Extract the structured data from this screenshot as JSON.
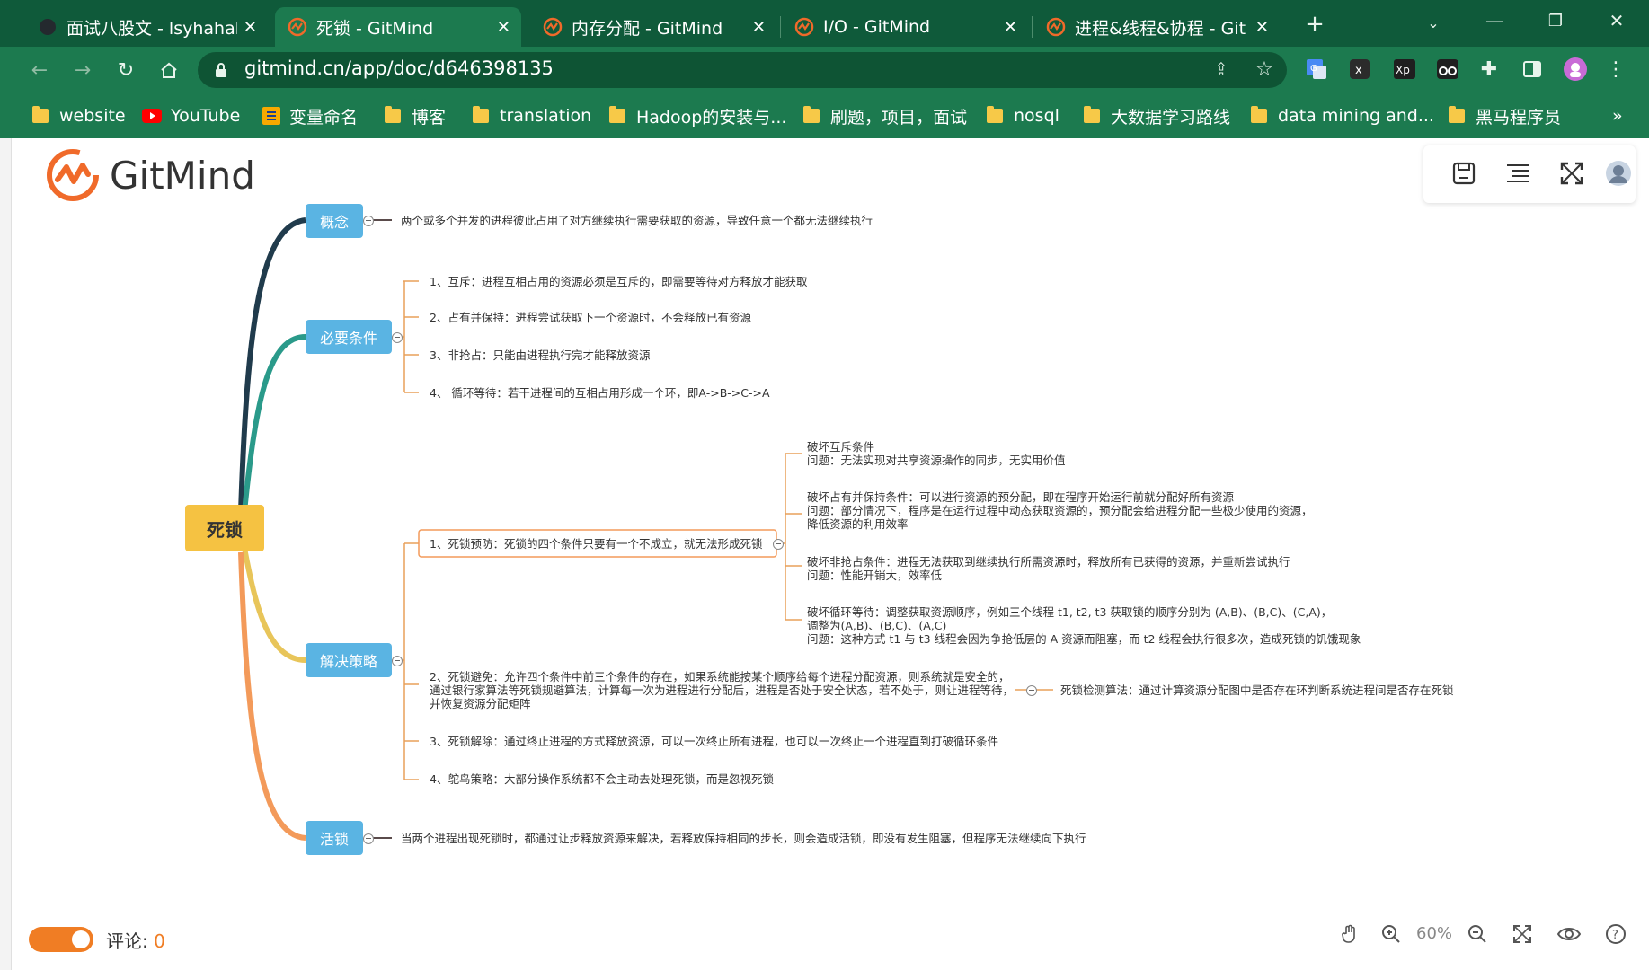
{
  "browser": {
    "tabs": [
      {
        "title": "面试八股文 - lsyhahah",
        "active": false
      },
      {
        "title": "死锁 - GitMind",
        "active": true
      },
      {
        "title": "内存分配 - GitMind",
        "active": false
      },
      {
        "title": "I/O - GitMind",
        "active": false
      },
      {
        "title": "进程&线程&协程 - Git",
        "active": false
      }
    ],
    "url": "gitmind.cn/app/doc/d646398135",
    "bookmarks": [
      {
        "label": "website",
        "icon": "folder-icon"
      },
      {
        "label": "YouTube",
        "icon": "youtube-icon"
      },
      {
        "label": "变量命名",
        "icon": "bookmark-icon"
      },
      {
        "label": "博客",
        "icon": "folder-icon"
      },
      {
        "label": "translation",
        "icon": "folder-icon"
      },
      {
        "label": "Hadoop的安装与...",
        "icon": "folder-icon"
      },
      {
        "label": "刷题，项目，面试",
        "icon": "folder-icon"
      },
      {
        "label": "nosql",
        "icon": "folder-icon"
      },
      {
        "label": "大数据学习路线",
        "icon": "folder-icon"
      },
      {
        "label": "data mining and...",
        "icon": "folder-icon"
      },
      {
        "label": "黑马程序员",
        "icon": "folder-icon"
      }
    ],
    "more_bookmarks": "»"
  },
  "app": {
    "logo_text": "GitMind",
    "zoom": "60%",
    "comment_label": "评论: ",
    "comment_count": "0",
    "colors": {
      "topic": "#5ab4e3",
      "root": "#f5c242",
      "logo": "#f06a2a"
    }
  },
  "mindmap": {
    "root": "死锁",
    "concept": {
      "label": "概念",
      "text": "两个或多个并发的进程彼此占用了对方继续执行需要获取的资源，导致任意一个都无法继续执行"
    },
    "conditions": {
      "label": "必要条件",
      "items": [
        "1、互斥：进程互相占用的资源必须是互斥的，即需要等待对方释放才能获取",
        "2、占有并保持：进程尝试获取下一个资源时，不会释放已有资源",
        "3、非抢占：只能由进程执行完才能释放资源",
        "4、 循环等待：若干进程间的互相占用形成一个环，即A->B->C->A"
      ]
    },
    "strategies": {
      "label": "解决策略",
      "prevention": "1、死锁预防：死锁的四个条件只要有一个不成立，就无法形成死锁",
      "prevention_details": [
        [
          "破坏互斥条件",
          "问题：无法实现对共享资源操作的同步，无实用价值"
        ],
        [
          "破坏占有并保持条件：可以进行资源的预分配，即在程序开始运行前就分配好所有资源",
          "问题：部分情况下，程序是在运行过程中动态获取资源的，预分配会给进程分配一些极少使用的资源，",
          "降低资源的利用效率"
        ],
        [
          "破坏非抢占条件：进程无法获取到继续执行所需资源时，释放所有已获得的资源，并重新尝试执行",
          "问题：性能开销大，效率低"
        ],
        [
          "破坏循环等待：调整获取资源顺序，例如三个线程 t1, t2, t3 获取锁的顺序分别为 (A,B)、(B,C)、(C,A)，",
          "调整为(A,B)、(B,C)、(A,C)",
          "问题：这种方式 t1 与 t3 线程会因为争抢低层的 A 资源而阻塞，而 t2 线程会执行很多次，造成死锁的饥饿现象"
        ]
      ],
      "avoidance": [
        "2、死锁避免：允许四个条件中前三个条件的存在，如果系统能按某个顺序给每个进程分配资源，则系统就是安全的，",
        "通过银行家算法等死锁规避算法，计算每一次为进程进行分配后，进程是否处于安全状态，若不处于，则让进程等待，",
        "并恢复资源分配矩阵"
      ],
      "detection": "死锁检测算法：通过计算资源分配图中是否存在环判断系统进程间是否存在死锁",
      "recovery": "3、死锁解除：通过终止进程的方式释放资源，可以一次终止所有进程，也可以一次终止一个进程直到打破循环条件",
      "ostrich": "4、鸵鸟策略：大部分操作系统都不会主动去处理死锁，而是忽视死锁"
    },
    "livelock": {
      "label": "活锁",
      "text": "当两个进程出现死锁时，都通过让步释放资源来解决，若释放保持相同的步长，则会造成活锁，即没有发生阻塞，但程序无法继续向下执行"
    }
  }
}
